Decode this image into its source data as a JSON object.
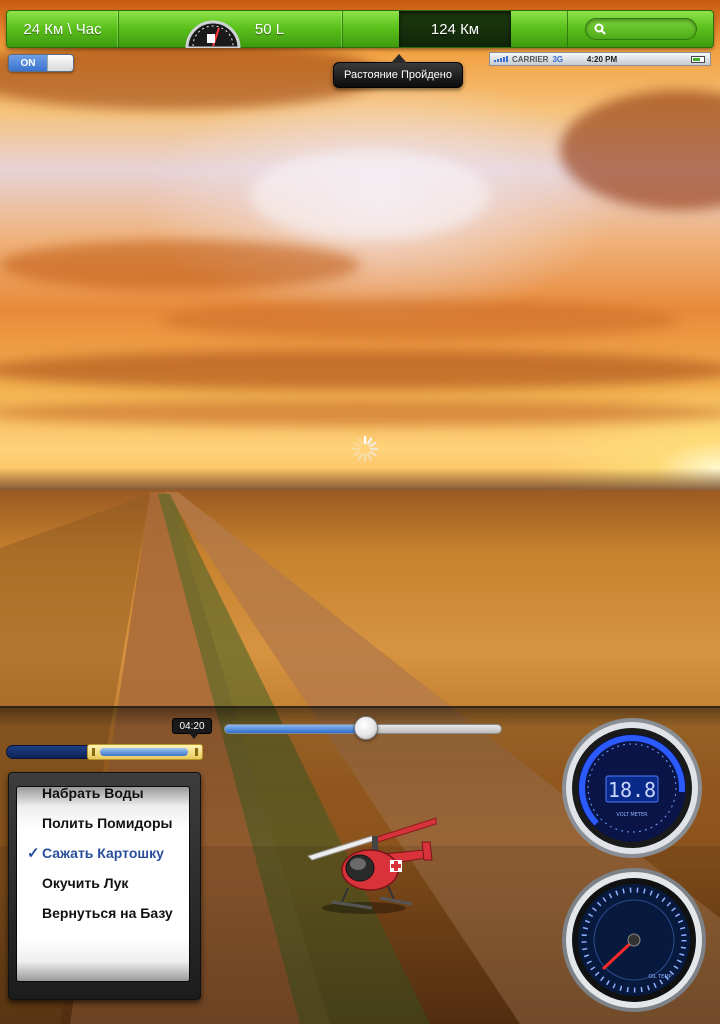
{
  "topbar": {
    "speed": "24 Км \\ Час",
    "fuel": "50 L",
    "distance": "124 Км",
    "distance_tooltip": "Растояние Пройдено",
    "search_icon": "search-icon",
    "accent": "#5cc21c"
  },
  "toggle": {
    "label": "ON",
    "state": "on"
  },
  "statusbar": {
    "carrier": "CARRIER",
    "network": "3G",
    "time": "4:20 PM"
  },
  "playback": {
    "time_label": "04:20",
    "slider_value": 0.51
  },
  "picker": {
    "items": [
      "Набрать Воды",
      "Полить Помидоры",
      "Сажать Картошку",
      "Окучить Лук",
      "Вернуться на Базу"
    ],
    "selected": "Сажать Картошку"
  },
  "gauges": {
    "digital_readout": "18.8",
    "digital_caption": "VOLT METER",
    "analog_caption": "OIL TEMP"
  }
}
